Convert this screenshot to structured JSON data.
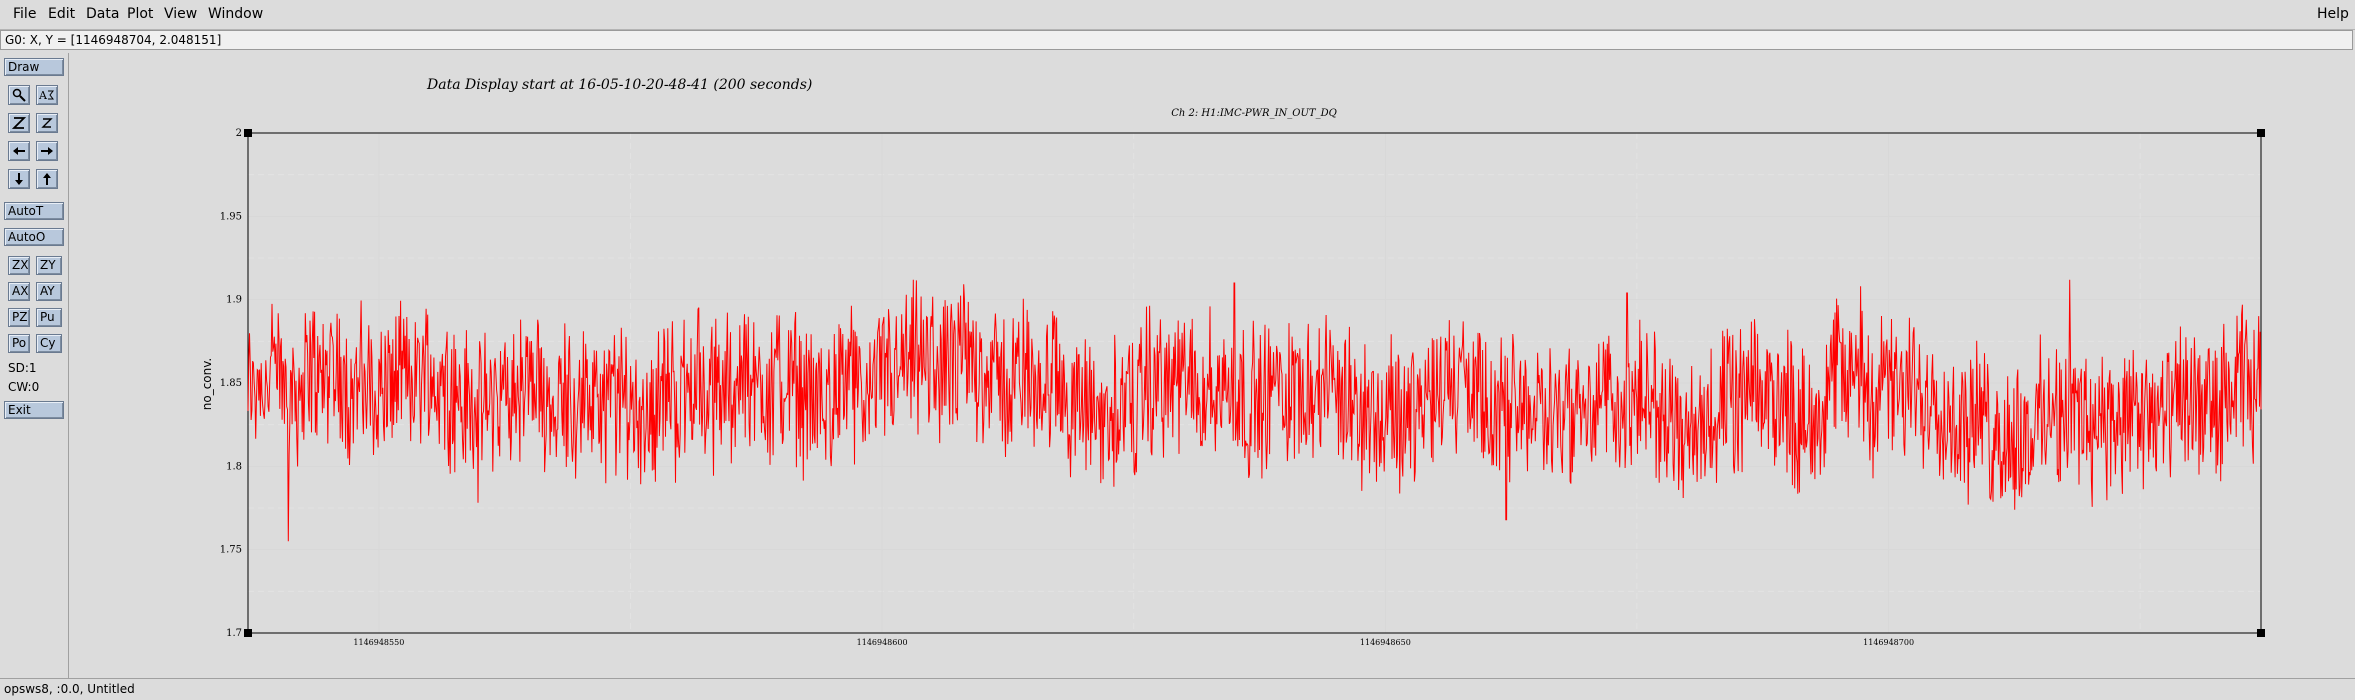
{
  "menu": {
    "file": "File",
    "edit": "Edit",
    "data": "Data",
    "plot": "Plot",
    "view": "View",
    "window": "Window",
    "help": "Help"
  },
  "coord_readout": "G0: X, Y = [1146948704, 2.048151]",
  "panel": {
    "draw": "Draw",
    "icons": [
      "magnifier-icon",
      "auto-scale-icon",
      "zoom-in-icon",
      "zoom-out-icon",
      "arrow-left-icon",
      "arrow-right-icon",
      "arrow-down-icon",
      "arrow-up-icon"
    ],
    "autoT": "AutoT",
    "autoO": "AutoO",
    "zx": "ZX",
    "zy": "ZY",
    "ax": "AX",
    "ay": "AY",
    "pz": "PZ",
    "pu": "Pu",
    "po": "Po",
    "cy": "Cy",
    "sd": "SD:1",
    "cw": "CW:0",
    "exit": "Exit"
  },
  "status": "opsws8, :0.0, Untitled",
  "chart_data": {
    "type": "line",
    "title": "Data Display start at 16-05-10-20-48-41 (200 seconds)",
    "subtitle": "Ch 2: H1:IMC-PWR_IN_OUT_DQ",
    "xlabel": "",
    "ylabel": "no_conv.",
    "xlim": [
      1146948537,
      1146948737
    ],
    "ylim": [
      1.7,
      2.0
    ],
    "x_ticks": [
      1146948550,
      1146948600,
      1146948650,
      1146948700
    ],
    "x_tick_labels": [
      "1146948550",
      "1146948600",
      "1146948650",
      "1146948700"
    ],
    "y_ticks": [
      1.7,
      1.75,
      1.8,
      1.85,
      1.9,
      1.95,
      2.0
    ],
    "y_tick_labels": [
      "1.7",
      "1.75",
      "1.8",
      "1.85",
      "1.9",
      "1.95",
      "2"
    ],
    "grid": true,
    "series_color": "#ff0000",
    "series": [
      {
        "values_summary": "noisy signal fluctuating around 1.84 between about 1.755 and 1.91",
        "mean": 1.843,
        "min": 1.755,
        "max": 1.912
      }
    ],
    "extrema": [
      {
        "x": 1146948541,
        "y": 1.755
      },
      {
        "x": 1146948635,
        "y": 1.91
      },
      {
        "x": 1146948674,
        "y": 1.904
      },
      {
        "x": 1146948718,
        "y": 1.912
      },
      {
        "x": 1146948662,
        "y": 1.768
      }
    ]
  }
}
